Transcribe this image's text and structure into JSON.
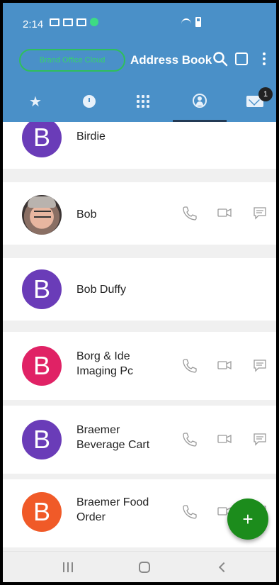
{
  "status_bar": {
    "time": "2:14"
  },
  "toolbar": {
    "brand_text": "Brand Office Cloud",
    "title": "Address Book"
  },
  "tabs": [
    {
      "name": "favorites",
      "icon": "star-icon"
    },
    {
      "name": "recents",
      "icon": "clock-icon"
    },
    {
      "name": "dialpad",
      "icon": "dialpad-icon"
    },
    {
      "name": "contacts",
      "icon": "contact-icon",
      "active": true
    },
    {
      "name": "messages",
      "icon": "envelope-icon",
      "badge": "1"
    }
  ],
  "contacts": [
    {
      "name": "Birdie",
      "initial": "B",
      "color": "#6a3cb8",
      "photo": false,
      "actions": false
    },
    {
      "name": "Bob",
      "initial": "",
      "color": "",
      "photo": true,
      "actions": true
    },
    {
      "name": "Bob Duffy",
      "initial": "B",
      "color": "#6a3cb8",
      "photo": false,
      "actions": false
    },
    {
      "name": "Borg & Ide Imaging Pc",
      "initial": "B",
      "color": "#e02265",
      "photo": false,
      "actions": true
    },
    {
      "name": "Braemer Beverage Cart",
      "initial": "B",
      "color": "#6a3cb8",
      "photo": false,
      "actions": true
    },
    {
      "name": "Braemer Food Order",
      "initial": "B",
      "color": "#f05a28",
      "photo": false,
      "actions": true
    }
  ],
  "fab": {
    "label": "+"
  },
  "colors": {
    "header": "#4a90c8",
    "fab": "#1c8c1c"
  }
}
